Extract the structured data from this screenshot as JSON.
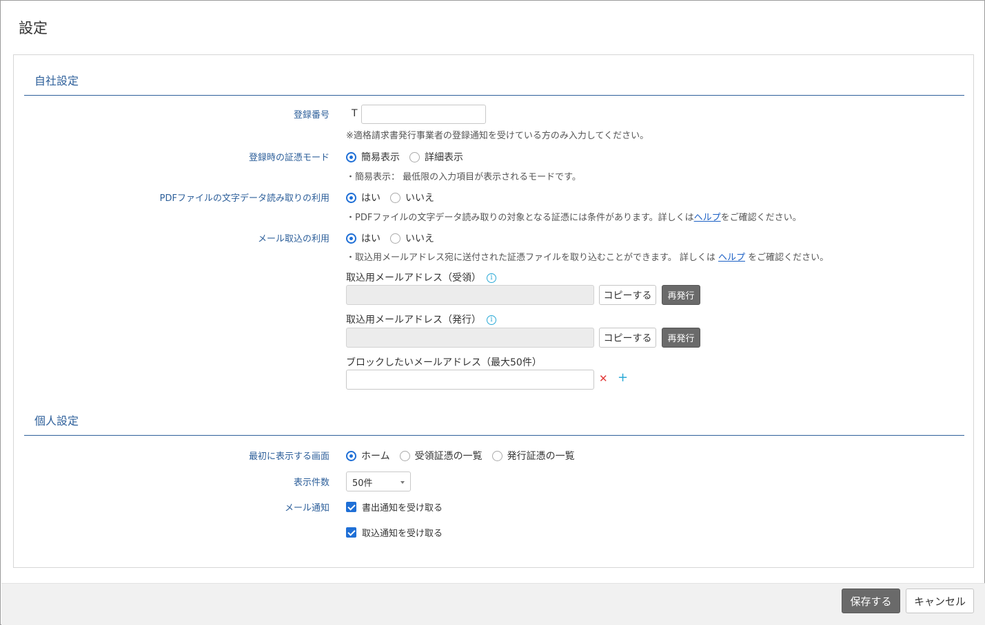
{
  "page": {
    "title": "設定"
  },
  "company": {
    "heading": "自社設定",
    "registration": {
      "label": "登録番号",
      "prefix": "T",
      "value": "",
      "note": "※適格請求書発行事業者の登録通知を受けている方のみ入力してください。"
    },
    "voucher_mode": {
      "label": "登録時の証憑モード",
      "options": [
        "簡易表示",
        "詳細表示"
      ],
      "selected": "簡易表示",
      "note": "・簡易表示： 最低限の入力項目が表示されるモードです。"
    },
    "pdf_ocr": {
      "label": "PDFファイルの文字データ読み取りの利用",
      "options": [
        "はい",
        "いいえ"
      ],
      "selected": "はい",
      "note_before": "・PDFファイルの文字データ読み取りの対象となる証憑には条件があります。詳しくは",
      "note_link": "ヘルプ",
      "note_after": "をご確認ください。"
    },
    "mail_import": {
      "label": "メール取込の利用",
      "options": [
        "はい",
        "いいえ"
      ],
      "selected": "はい",
      "note_before": "・取込用メールアドレス宛に送付された証憑ファイルを取り込むことができます。 詳しくは ",
      "note_link": "ヘルプ",
      "note_after": " をご確認ください。",
      "receive_address": {
        "label": "取込用メールアドレス（受領）",
        "copy_label": "コピーする",
        "reissue_label": "再発行"
      },
      "issue_address": {
        "label": "取込用メールアドレス（発行）",
        "copy_label": "コピーする",
        "reissue_label": "再発行"
      },
      "block": {
        "label": "ブロックしたいメールアドレス（最大50件）",
        "value": ""
      }
    }
  },
  "personal": {
    "heading": "個人設定",
    "start_screen": {
      "label": "最初に表示する画面",
      "options": [
        "ホーム",
        "受領証憑の一覧",
        "発行証憑の一覧"
      ],
      "selected": "ホーム"
    },
    "page_size": {
      "label": "表示件数",
      "selected": "50件"
    },
    "mail_notice": {
      "label": "メール通知",
      "options": [
        {
          "label": "書出通知を受け取る",
          "checked": true
        },
        {
          "label": "取込通知を受け取る",
          "checked": true
        }
      ]
    }
  },
  "footer": {
    "save_label": "保存する",
    "cancel_label": "キャンセル"
  },
  "colors": {
    "accent": "#2d5f9a",
    "radio": "#1f6fd6",
    "info": "#29a9d6",
    "remove": "#e23b3b",
    "link": "#1a5fc4"
  },
  "icons": {
    "info": "info-icon",
    "remove": "close-icon",
    "add": "plus-icon"
  }
}
